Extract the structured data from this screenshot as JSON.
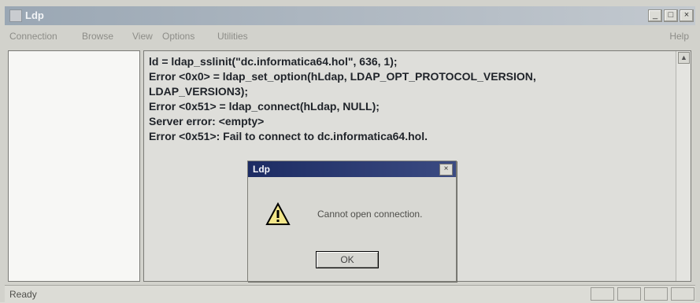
{
  "window": {
    "title": "Ldp",
    "controls": {
      "minimize": "_",
      "maximize": "□",
      "close": "×"
    }
  },
  "menu": {
    "items": [
      "Connection",
      "Browse",
      "View",
      "Options",
      "Utilities"
    ],
    "help": "Help"
  },
  "log": {
    "lines": [
      "ld = ldap_sslinit(\"dc.informatica64.hol\", 636, 1);",
      "Error <0x0> = ldap_set_option(hLdap, LDAP_OPT_PROTOCOL_VERSION,",
      "LDAP_VERSION3);",
      "Error <0x51> = ldap_connect(hLdap, NULL);",
      "Server error: <empty>",
      "Error <0x51>: Fail to connect to dc.informatica64.hol."
    ]
  },
  "dialog": {
    "title": "Ldp",
    "close": "×",
    "message": "Cannot open connection.",
    "ok_label": "OK",
    "icon": "warning-icon"
  },
  "status": {
    "text": "Ready"
  },
  "scroll": {
    "up": "▲"
  }
}
